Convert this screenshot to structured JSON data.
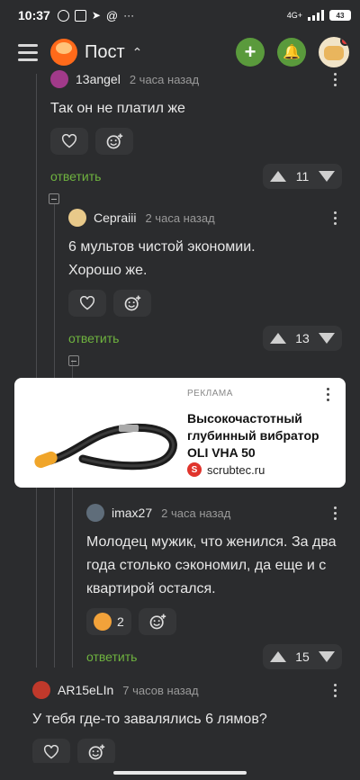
{
  "status": {
    "time": "10:37",
    "network": "4G+",
    "battery": "43"
  },
  "header": {
    "title": "Пост"
  },
  "comments": [
    {
      "author": "13angel",
      "time": "2 часа назад",
      "text": "Так он не платил же",
      "reply": "ответить",
      "rating": "11"
    },
    {
      "author": "Cepraiii",
      "time": "2 часа назад",
      "text": "6 мультов чистой экономии. Хорошо же.",
      "reply": "ответить",
      "rating": "13"
    },
    {
      "author": "imax27",
      "time": "2 часа назад",
      "text": "Молодец мужик, что женился. За два года столько сэкономил, да еще и с квартирой остался.",
      "reaction_count": "2",
      "reply": "ответить",
      "rating": "15"
    },
    {
      "author": "AR15eLIn",
      "time": "7 часов назад",
      "text": "У тебя где-то завалялись 6 лямов?"
    }
  ],
  "ad": {
    "label": "РЕКЛАМА",
    "title": "Высокочастотный глубинный вибратор OLI VHA 50",
    "source": "scrubtec.ru"
  },
  "icons": {
    "menu": "hamburger-icon",
    "logo": "pikabu-logo",
    "add": "plus-icon",
    "bell": "bell-icon",
    "like": "heart-icon",
    "react": "smiley-plus-icon",
    "up": "triangle-up-icon",
    "down": "triangle-down-icon"
  },
  "colors": {
    "accent": "#5a9a3c",
    "reply": "#6fb33f",
    "bg": "#2b2c2e"
  }
}
